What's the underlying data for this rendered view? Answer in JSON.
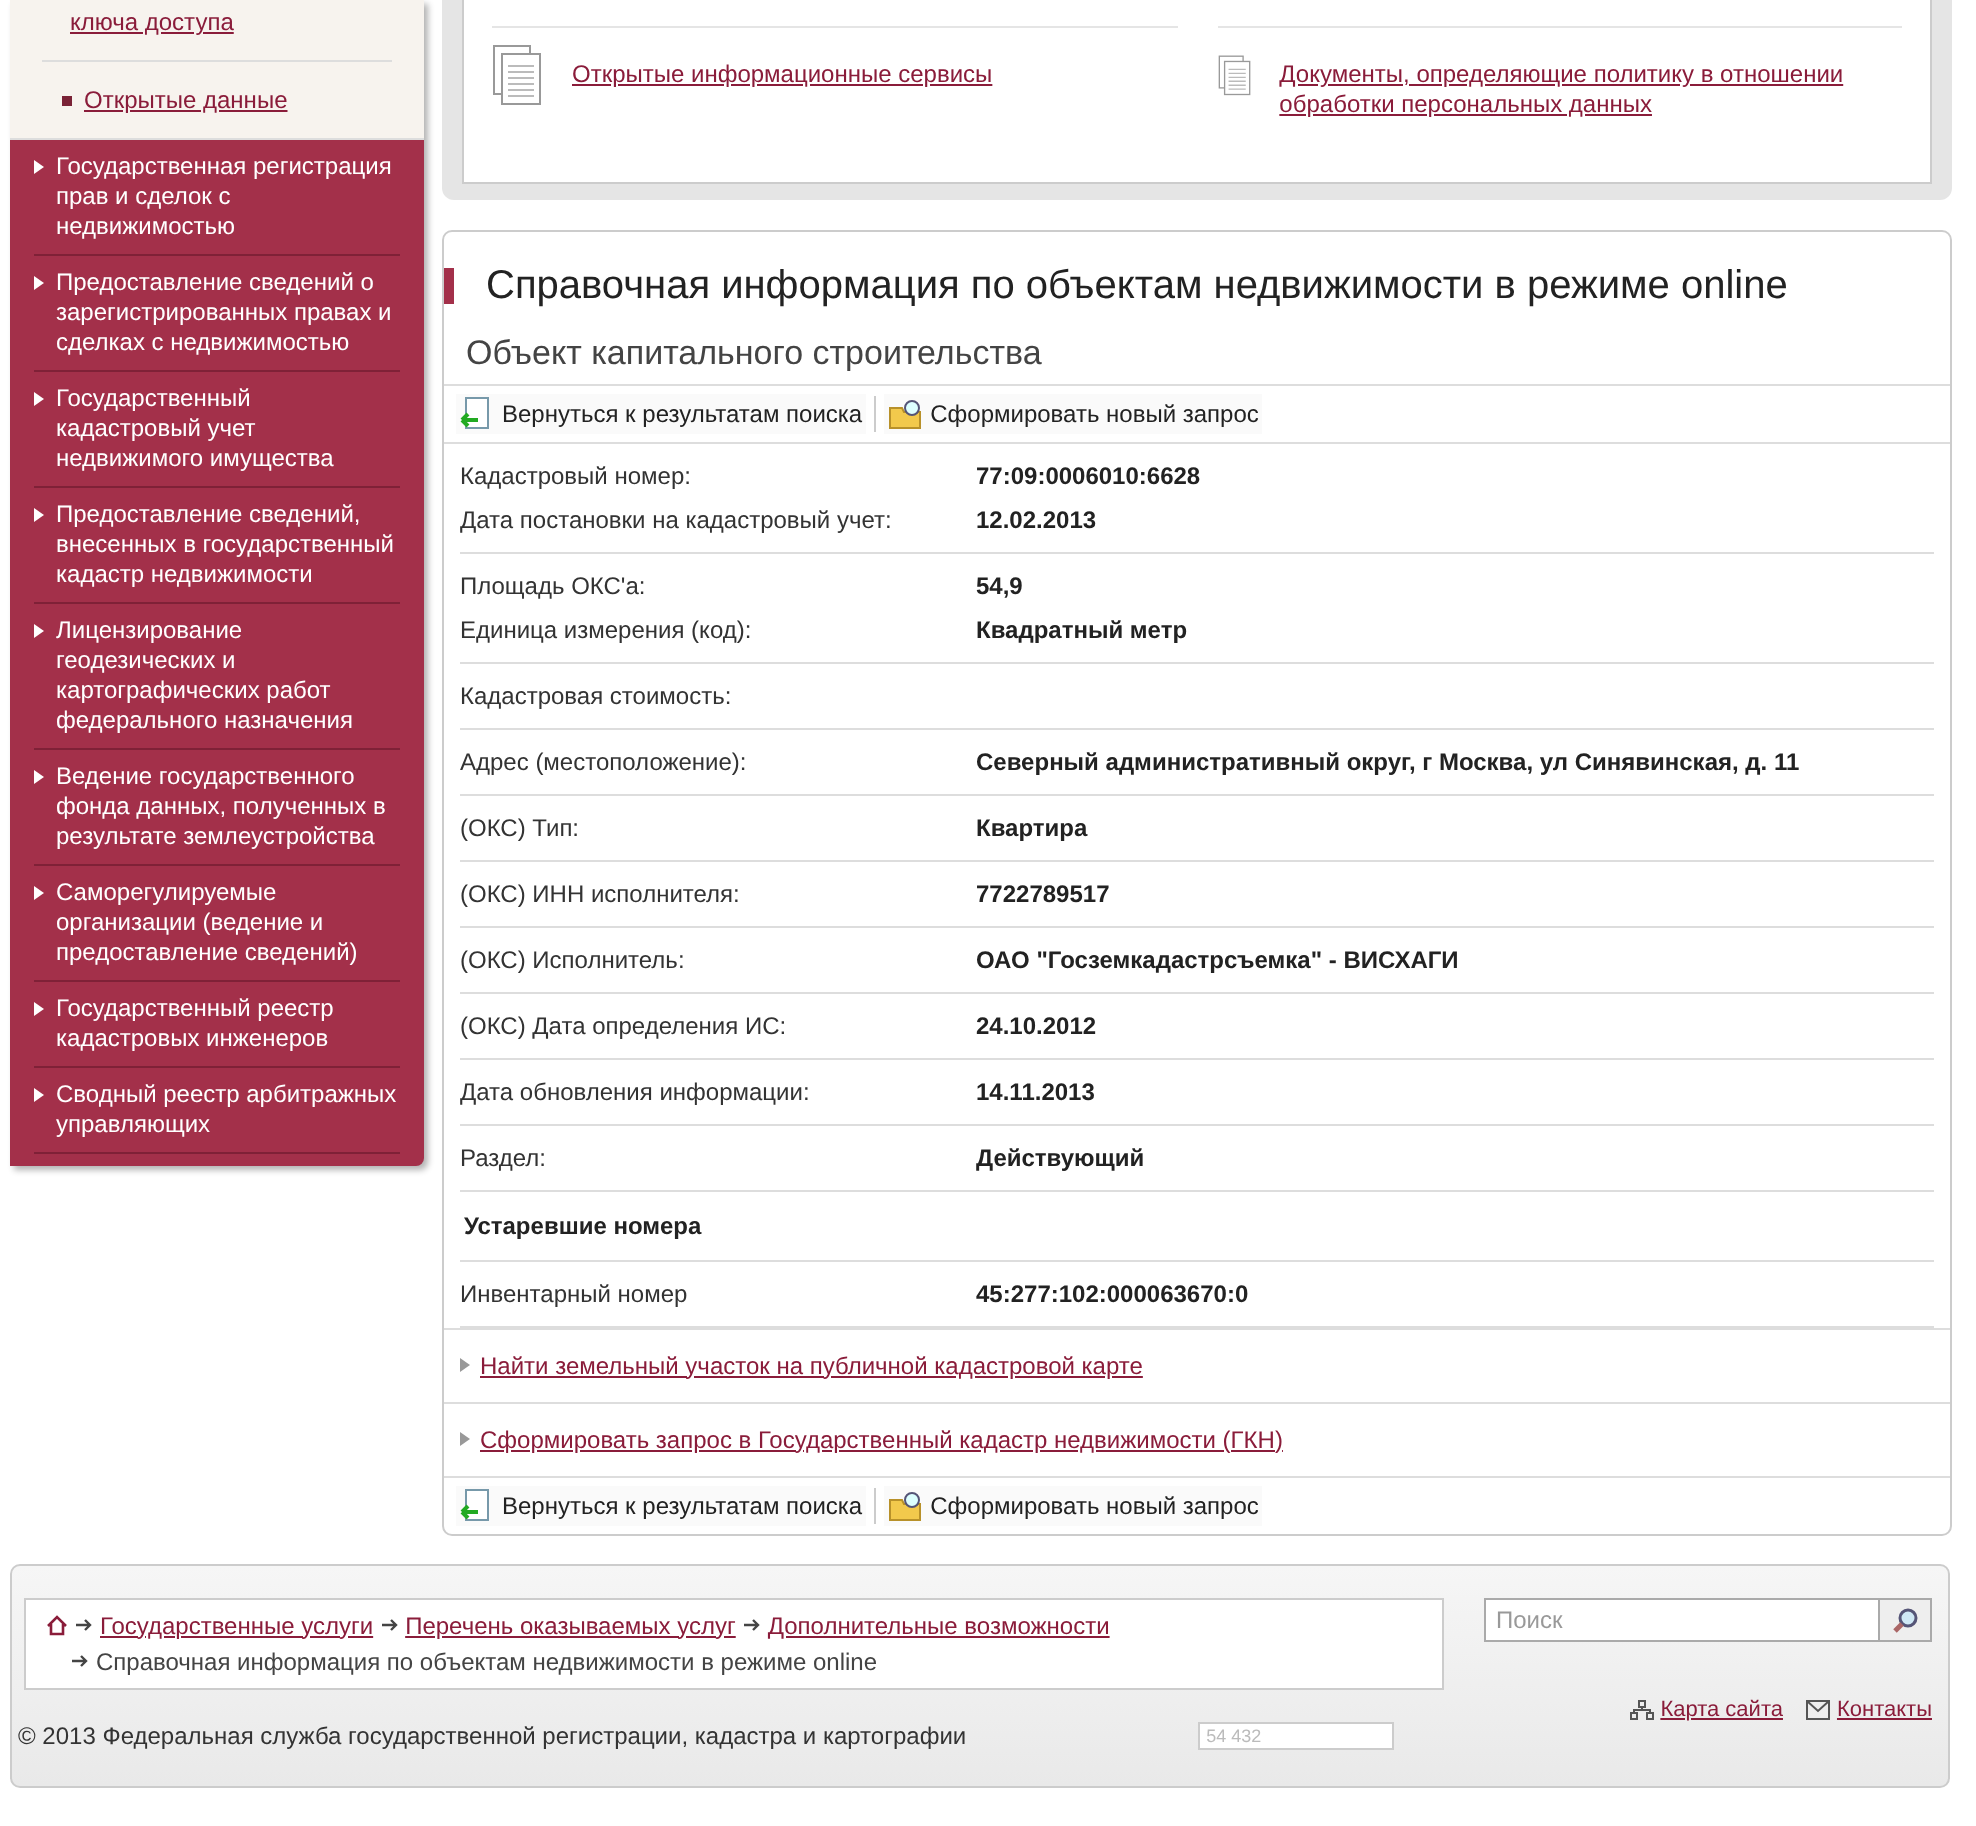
{
  "sidebar": {
    "submenu": [
      {
        "label": "ключа доступа",
        "bullet": false
      },
      {
        "label": "Открытые данные",
        "bullet": true
      }
    ],
    "items": [
      "Государственная регистрация прав и сделок с недвижимостью",
      "Предоставление сведений о зарегистрированных правах и сделках с недвижимостью",
      "Государственный кадастровый учет недвижимого имущества",
      "Предоставление сведений, внесенных в государственный кадастр недвижимости",
      "Лицензирование геодезических и картографических работ федерального назначения",
      "Ведение государственного фонда данных, полученных в результате землеустройства",
      "Саморегулируемые организации (ведение и предоставление сведений)",
      "Государственный реестр кадастровых инженеров",
      "Сводный реестр арбитражных управляющих"
    ]
  },
  "top_links": [
    "Открытые информационные сервисы",
    "Документы, определяющие политику в отношении обработки персональных данных"
  ],
  "main": {
    "title": "Справочная информация по объектам недвижимости в режиме online",
    "subtitle": "Объект капитального строительства",
    "toolbar_top": [
      "Вернуться к результатам поиска",
      "Сформировать новый запрос"
    ],
    "sections": [
      {
        "kind": "group",
        "rows": [
          {
            "label": "Кадастровый номер:",
            "value": "77:09:0006010:6628"
          },
          {
            "label": "Дата постановки на кадастровый учет:",
            "value": "12.02.2013"
          }
        ]
      },
      {
        "kind": "group",
        "rows": [
          {
            "label": "Площадь ОКС'а:",
            "value": "54,9"
          },
          {
            "label": "Единица измерения (код):",
            "value": "Квадратный метр"
          }
        ]
      },
      {
        "kind": "group",
        "rows": [
          {
            "label": "Кадастровая стоимость:"
          }
        ]
      },
      {
        "kind": "group",
        "rows": [
          {
            "label": "Адрес (местоположение):",
            "value": "Северный административный округ, г Москва, ул Синявинская, д. 11"
          }
        ]
      },
      {
        "kind": "group",
        "rows": [
          {
            "label": "(ОКС) Тип:",
            "value": "Квартира"
          }
        ]
      },
      {
        "kind": "group",
        "rows": [
          {
            "label": "(ОКС) ИНН исполнителя:",
            "value": "7722789517"
          }
        ]
      },
      {
        "kind": "group",
        "rows": [
          {
            "label": "(ОКС) Исполнитель:",
            "value": "ОАО \"Госземкадастрсъемка\" - ВИСХАГИ"
          }
        ]
      },
      {
        "kind": "group",
        "rows": [
          {
            "label": "(ОКС) Дата определения ИС:",
            "value": "24.10.2012"
          }
        ]
      },
      {
        "kind": "group",
        "rows": [
          {
            "label": "Дата обновления информации:",
            "value": "14.11.2013"
          }
        ]
      },
      {
        "kind": "group",
        "rows": [
          {
            "label": "Раздел:",
            "value": "Действующий"
          }
        ]
      },
      {
        "kind": "heading",
        "text": "Устаревшие номера"
      },
      {
        "kind": "group",
        "rows": [
          {
            "label": "Инвентарный номер",
            "value": "45:277:102:000063670:0"
          }
        ]
      }
    ],
    "links": [
      "Найти земельный участок на публичной кадастровой карте",
      "Сформировать запрос в Государственный кадастр недвижимости (ГКН)"
    ],
    "toolbar_bottom": [
      "Вернуться к результатам поиска",
      "Сформировать новый запрос"
    ]
  },
  "footer": {
    "breadcrumbs": [
      "Государственные услуги",
      "Перечень оказываемых услуг",
      "Дополнительные возможности"
    ],
    "current": "Справочная информация по объектам недвижимости в режиме online",
    "search": {
      "placeholder": "Поиск"
    },
    "links": [
      "Карта сайта",
      "Контакты"
    ],
    "copyright": "© 2013 Федеральная служба государственной регистрации, кадастра и картографии",
    "counter": "54 432"
  }
}
